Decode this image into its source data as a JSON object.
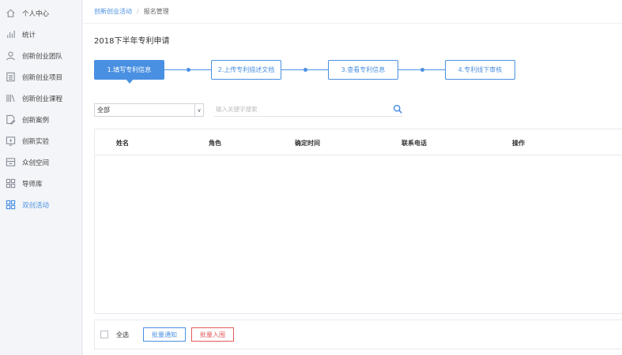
{
  "sidebar": {
    "items": [
      {
        "label": "个人中心",
        "icon": "house-icon"
      },
      {
        "label": "统计",
        "icon": "bar-chart-icon"
      },
      {
        "label": "创新创业团队",
        "icon": "user-icon"
      },
      {
        "label": "创新创业项目",
        "icon": "document-list-icon"
      },
      {
        "label": "创新创业课程",
        "icon": "books-icon"
      },
      {
        "label": "创新案例",
        "icon": "file-edit-icon"
      },
      {
        "label": "创新实验",
        "icon": "lab-window-icon"
      },
      {
        "label": "众创空间",
        "icon": "workspace-icon"
      },
      {
        "label": "导师库",
        "icon": "grid-icon"
      },
      {
        "label": "双创活动",
        "icon": "grid-icon",
        "active": true
      }
    ]
  },
  "breadcrumb": {
    "link": "创新创业活动",
    "separator": "/",
    "current": "报名管理"
  },
  "page": {
    "title": "2018下半年专利申请"
  },
  "steps": [
    {
      "label": "1.填写专利信息",
      "active": true
    },
    {
      "label": "2.上传专利描述文档",
      "active": false
    },
    {
      "label": "3.查看专利信息",
      "active": false
    },
    {
      "label": "4.专利线下审核",
      "active": false
    }
  ],
  "filter": {
    "select_value": "全部",
    "select_arrow": "∨",
    "search_placeholder": "输入关键字搜索",
    "search_value": ""
  },
  "table": {
    "columns": [
      "姓名",
      "角色",
      "确定时间",
      "联系电话",
      "操作"
    ],
    "rows": []
  },
  "footer": {
    "select_all_label": "全选",
    "batch_notify_label": "批量通知",
    "batch_admit_label": "批量入围"
  },
  "colors": {
    "accent": "#4a90e2",
    "danger": "#e25b5b"
  }
}
